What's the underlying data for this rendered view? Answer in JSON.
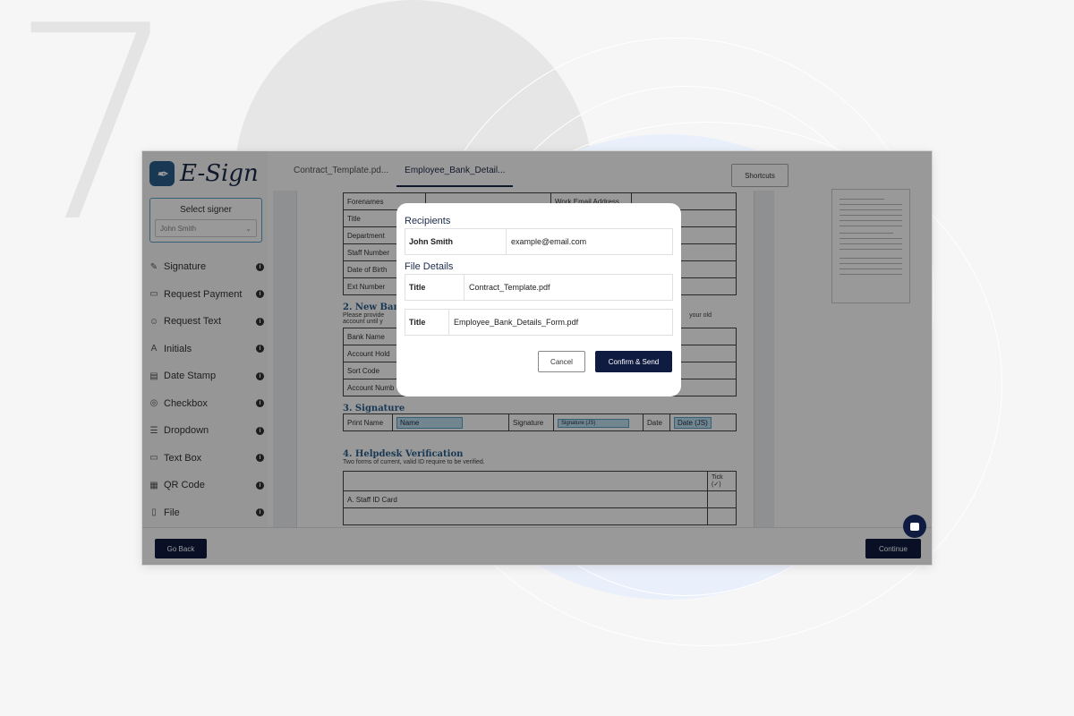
{
  "background": {
    "step_number": "7"
  },
  "app": {
    "logo_text": "E-Sign",
    "select_signer_label": "Select signer",
    "selected_signer": "John Smith",
    "tools": [
      {
        "label": "Signature",
        "icon": "signature-icon"
      },
      {
        "label": "Request Payment",
        "icon": "card-icon"
      },
      {
        "label": "Request Text",
        "icon": "person-text-icon"
      },
      {
        "label": "Initials",
        "icon": "initials-icon"
      },
      {
        "label": "Date Stamp",
        "icon": "calendar-icon"
      },
      {
        "label": "Checkbox",
        "icon": "checkbox-icon"
      },
      {
        "label": "Dropdown",
        "icon": "dropdown-icon"
      },
      {
        "label": "Text Box",
        "icon": "textbox-icon"
      },
      {
        "label": "QR Code",
        "icon": "qr-icon"
      },
      {
        "label": "File",
        "icon": "file-icon"
      }
    ],
    "tabs": [
      "Contract_Template.pd...",
      "Employee_Bank_Detail..."
    ],
    "shortcuts_label": "Shortcuts",
    "go_back_label": "Go Back",
    "continue_label": "Continue"
  },
  "document": {
    "personal_rows": [
      [
        "Forenames",
        "",
        "Work Email Address",
        ""
      ],
      [
        "Title",
        "",
        "",
        ""
      ],
      [
        "Department",
        "",
        "",
        ""
      ],
      [
        "Staff Number",
        "",
        "",
        ""
      ],
      [
        "Date of Birth",
        "",
        "",
        ""
      ],
      [
        "Ext Number",
        "",
        "",
        ""
      ]
    ],
    "section2_title": "2. New Ban",
    "section2_text": "Please provide",
    "section2_text2": "account until y",
    "section2_text_right": "your old",
    "bank_rows": [
      "Bank Name",
      "Account Hold",
      "Sort Code",
      "Account Numb"
    ],
    "section3_title": "3. Signature",
    "sig_print_name": "Print Name",
    "sig_name_field": "Name",
    "sig_signature": "Signature",
    "sig_signature_field": "Signature (JS)",
    "sig_date": "Date",
    "sig_date_field": "Date (JS)",
    "section4_title": "4. Helpdesk Verification",
    "section4_text": "Two forms of current, valid ID require to be verified.",
    "tick_header": "Tick (✓)",
    "id_row": "A.  Staff ID Card"
  },
  "modal": {
    "recipients_heading": "Recipients",
    "recipient_name": "John Smith",
    "recipient_email": "example@email.com",
    "file_details_heading": "File Details",
    "files": [
      {
        "key": "Title",
        "value": "Contract_Template.pdf"
      },
      {
        "key": "Title",
        "value": "Employee_Bank_Details_Form.pdf"
      }
    ],
    "cancel_label": "Cancel",
    "confirm_label": "Confirm & Send"
  }
}
